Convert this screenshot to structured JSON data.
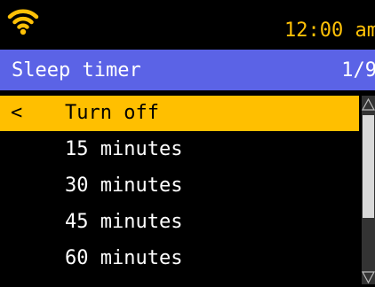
{
  "status_bar": {
    "time": "12:00 am",
    "wifi_icon": "wifi-icon",
    "accent_color": "#ffc107"
  },
  "header": {
    "title": "Sleep timer",
    "page_counter": "1/9",
    "background_color": "#5b63e6"
  },
  "menu": {
    "back_glyph": "<",
    "selected_color": "#ffbf00",
    "items": [
      {
        "label": "Turn off",
        "selected": true
      },
      {
        "label": "15 minutes",
        "selected": false
      },
      {
        "label": "30 minutes",
        "selected": false
      },
      {
        "label": "45 minutes",
        "selected": false
      },
      {
        "label": "60 minutes",
        "selected": false
      }
    ]
  },
  "scrollbar": {
    "up_icon": "triangle-up-icon",
    "down_icon": "triangle-down-icon"
  }
}
